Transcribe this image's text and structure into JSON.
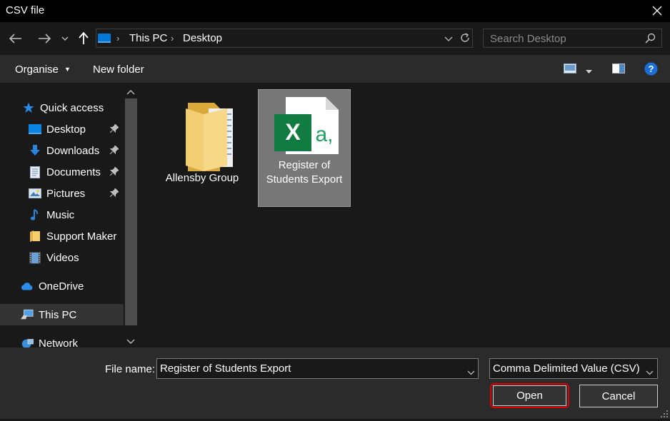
{
  "window": {
    "title": "CSV file"
  },
  "navbar": {
    "breadcrumb": [
      "This PC",
      "Desktop"
    ],
    "search_placeholder": "Search Desktop"
  },
  "cmdbar": {
    "organise": "Organise",
    "new_folder": "New folder"
  },
  "sidebar": {
    "quick_access": "Quick access",
    "items": [
      {
        "label": "Desktop",
        "icon": "desktop-icon",
        "pinned": true
      },
      {
        "label": "Downloads",
        "icon": "download-icon",
        "pinned": true
      },
      {
        "label": "Documents",
        "icon": "document-icon",
        "pinned": true
      },
      {
        "label": "Pictures",
        "icon": "pictures-icon",
        "pinned": true
      },
      {
        "label": "Music",
        "icon": "music-icon",
        "pinned": false
      },
      {
        "label": "Support Maker",
        "icon": "folder-icon",
        "pinned": false
      },
      {
        "label": "Videos",
        "icon": "videos-icon",
        "pinned": false
      }
    ],
    "onedrive": "OneDrive",
    "this_pc": "This PC",
    "network": "Network"
  },
  "files": [
    {
      "name": "Allensby Group",
      "type": "folder"
    },
    {
      "name_line1": "Register of",
      "name_line2": "Students Export",
      "type": "excel-csv",
      "selected": true
    }
  ],
  "bottom": {
    "file_name_label": "File name:",
    "file_name_value": "Register of Students Export",
    "filter_value": "Comma Delimited Value (CSV)",
    "open": "Open",
    "cancel": "Cancel"
  },
  "colors": {
    "accent": "#0078d7",
    "open_highlight": "#e00000",
    "excel_green": "#107c41"
  }
}
